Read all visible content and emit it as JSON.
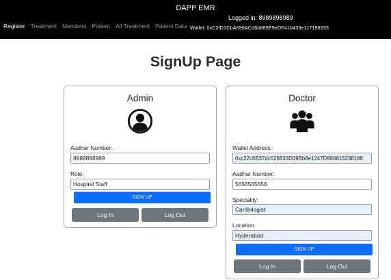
{
  "navbar": {
    "brand": "DAPP EMR",
    "logged_in": "Logged in: 8989898989",
    "wallet": "Wallet: 0xC2fD1CbA696ACd6b885E9eDF41b433e117198333",
    "links": [
      "Register",
      "Treatment",
      "Members",
      "Patient",
      "All Treatment",
      "Patient Data"
    ],
    "active_link": "Register"
  },
  "page": {
    "title": "SignUp Page"
  },
  "admin_card": {
    "title": "Admin",
    "icon": "user-circle-icon",
    "aadhar_label": "Aadhar Number:",
    "aadhar_value": "8989898989",
    "role_label": "Role:",
    "role_value": "Hospital Staff",
    "signup_label": "SIGN UP",
    "login_label": "Log In",
    "logout_label": "Log Out"
  },
  "doctor_card": {
    "title": "Doctor",
    "icon": "users-group-icon",
    "wallet_label": "Wallet Address:",
    "wallet_value": "0xc22c6B37dc526833D09Bb8e1247D966815238186",
    "aadhar_label": "Aadhar Number:",
    "aadhar_value": "5656565656",
    "speciality_label": "Speciality:",
    "speciality_value": "Cardiologist",
    "location_label": "Location:",
    "location_value": "Hyderabad",
    "signup_label": "SIGN UP",
    "login_label": "Log In",
    "logout_label": "Log Out"
  },
  "colors": {
    "navbar_bg": "#000000",
    "primary": "#0d6efd",
    "secondary": "#6c757d",
    "autofill_bg": "#e8f0fe"
  }
}
